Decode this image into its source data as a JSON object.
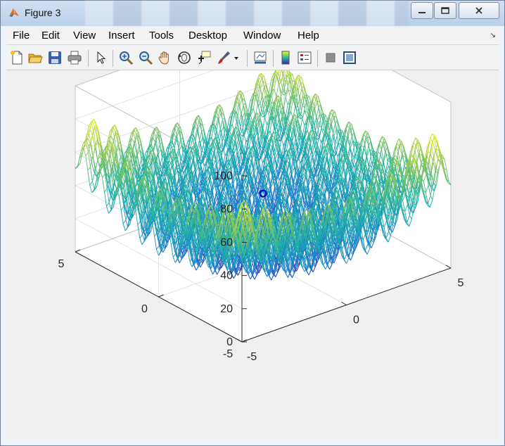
{
  "window": {
    "title": "Figure 3"
  },
  "menu": [
    "File",
    "Edit",
    "View",
    "Insert",
    "Tools",
    "Desktop",
    "Window",
    "Help"
  ],
  "toolbar_icons": [
    "new-figure-icon",
    "open-file-icon",
    "save-icon",
    "print-icon",
    "pointer-icon",
    "zoom-in-icon",
    "zoom-out-icon",
    "pan-hand-icon",
    "rotate-3d-icon",
    "data-cursor-icon",
    "brush-icon",
    "brush-dropdown-icon",
    "link-plot-icon",
    "colorbar-icon",
    "legend-icon",
    "hide-plot-tools-icon",
    "show-plot-tools-icon"
  ],
  "chart_data": {
    "type": "surface",
    "title": "",
    "xlabel": "",
    "ylabel": "",
    "zlabel": "",
    "x_ticks": [
      "-5",
      "0",
      "5"
    ],
    "y_ticks": [
      "-5",
      "0",
      "5"
    ],
    "z_ticks": [
      "0",
      "20",
      "40",
      "60",
      "80",
      "100"
    ],
    "xlim": [
      -5,
      5
    ],
    "ylim": [
      -5,
      5
    ],
    "zlim": [
      0,
      100
    ],
    "grid": true,
    "colormap": "parula",
    "series": {
      "surface_grid_x": [
        -5,
        -4.5,
        -4,
        -3.5,
        -3,
        -2.5,
        -2,
        -1.5,
        -1,
        -0.5,
        0,
        0.5,
        1,
        1.5,
        2,
        2.5,
        3,
        3.5,
        4,
        4.5,
        5
      ],
      "surface_grid_y": [
        -5,
        -4.5,
        -4,
        -3.5,
        -3,
        -2.5,
        -2,
        -1.5,
        -1,
        -0.5,
        0,
        0.5,
        1,
        1.5,
        2,
        2.5,
        3,
        3.5,
        4,
        4.5,
        5
      ],
      "surface_formula": "20 + x^2 + y^2 - 10(cos(2*pi*x) + cos(2*pi*y))",
      "marker_point": {
        "x": 0,
        "y": 0,
        "z": 40
      }
    },
    "colors": {
      "low": "#3e26a8",
      "mid": "#20b2aa",
      "high": "#f9fb0e",
      "marker": "#0000cc"
    }
  }
}
